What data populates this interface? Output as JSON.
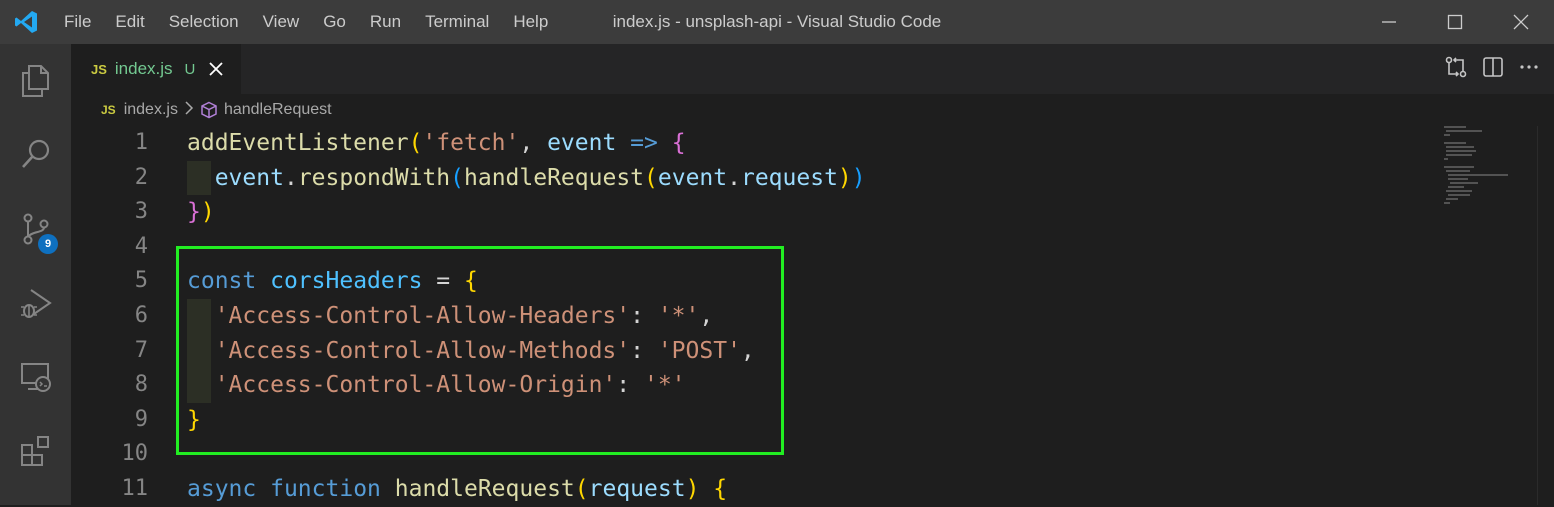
{
  "window": {
    "title": "index.js - unsplash-api - Visual Studio Code"
  },
  "menu": [
    "File",
    "Edit",
    "Selection",
    "View",
    "Go",
    "Run",
    "Terminal",
    "Help"
  ],
  "activity_bar": {
    "items": [
      "explorer-icon",
      "search-icon",
      "source-control-icon",
      "run-debug-icon",
      "remote-explorer-icon",
      "extensions-icon"
    ],
    "source_control_badge": "9"
  },
  "tab": {
    "lang_badge": "JS",
    "filename": "index.js",
    "status": "U"
  },
  "breadcrumb": {
    "lang_badge": "JS",
    "file": "index.js",
    "symbol": "handleRequest"
  },
  "editor": {
    "line_numbers": [
      "1",
      "2",
      "3",
      "4",
      "5",
      "6",
      "7",
      "8",
      "9",
      "10",
      "11"
    ]
  },
  "colors": {
    "highlight_border": "#22ee22",
    "keyword": "#569cd6",
    "function": "#dcdcaa",
    "string": "#ce9178",
    "variable": "#9cdcfe",
    "const": "#4fc1ff",
    "untracked": "#73c991"
  }
}
